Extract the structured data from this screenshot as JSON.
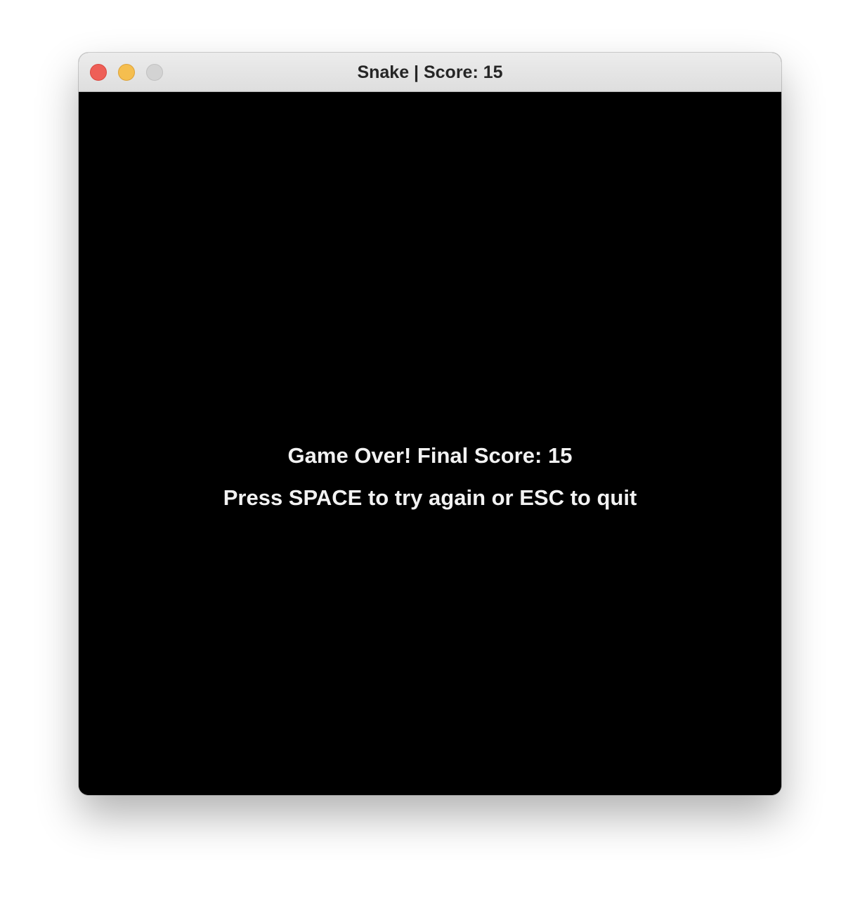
{
  "window": {
    "title": "Snake | Score: 15",
    "controls": {
      "close": "close-icon",
      "minimize": "minimize-icon",
      "zoom": "zoom-icon"
    },
    "colors": {
      "close": "#ee5f57",
      "minimize": "#f5be4f",
      "zoom": "#d3d3d3"
    }
  },
  "game": {
    "background": "#000000",
    "text_color": "#f2f2f2",
    "game_over_message": "Game Over! Final Score: 15",
    "instructions": "Press SPACE to try again or ESC to quit",
    "score": 15
  }
}
